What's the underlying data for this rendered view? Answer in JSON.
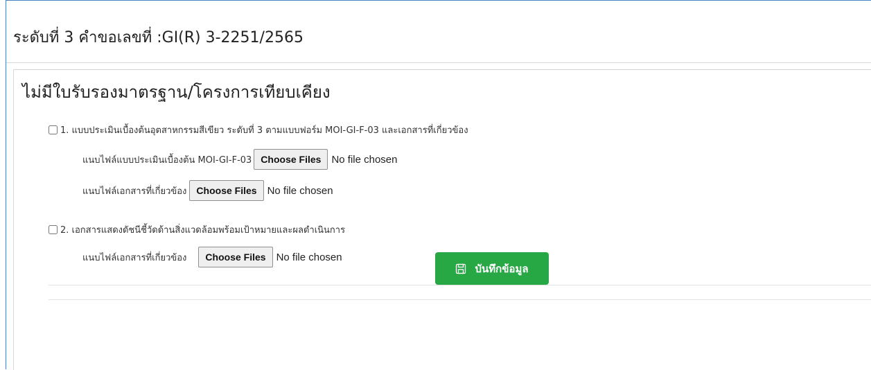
{
  "header": {
    "title": "ระดับที่ 3 คำขอเลขที่ :GI(R) 3-2251/2565"
  },
  "section": {
    "title": "ไม่มีใบรับรองมาตรฐาน/โครงการเทียบเคียง"
  },
  "items": [
    {
      "label": "1. แบบประเมินเบื้องต้นอุตสาหกรรมสีเขียว ระดับที่ 3 ตามแบบฟอร์ม MOI-GI-F-03 และเอกสารที่เกี่ยวข้อง",
      "checked": false,
      "files": [
        {
          "label": "แนบไฟล์แบบประเมินเบื้องต้น MOI-GI-F-03",
          "button": "Choose Files",
          "status": "No file chosen"
        },
        {
          "label": "แนบไฟล์เอกสารที่เกี่ยวข้อง",
          "button": "Choose Files",
          "status": "No file chosen"
        }
      ]
    },
    {
      "label": "2. เอกสารแสดงดัชนีชี้วัดด้านสิ่งแวดล้อมพร้อมเป้าหมายและผลดำเนินการ",
      "checked": false,
      "files": [
        {
          "label": "แนบไฟล์เอกสารที่เกี่ยวข้อง",
          "button": "Choose Files",
          "status": "No file chosen"
        }
      ]
    }
  ],
  "save_button": {
    "label": "บันทึกข้อมูล",
    "icon": "floppy-disk-icon",
    "color": "#28a745"
  }
}
